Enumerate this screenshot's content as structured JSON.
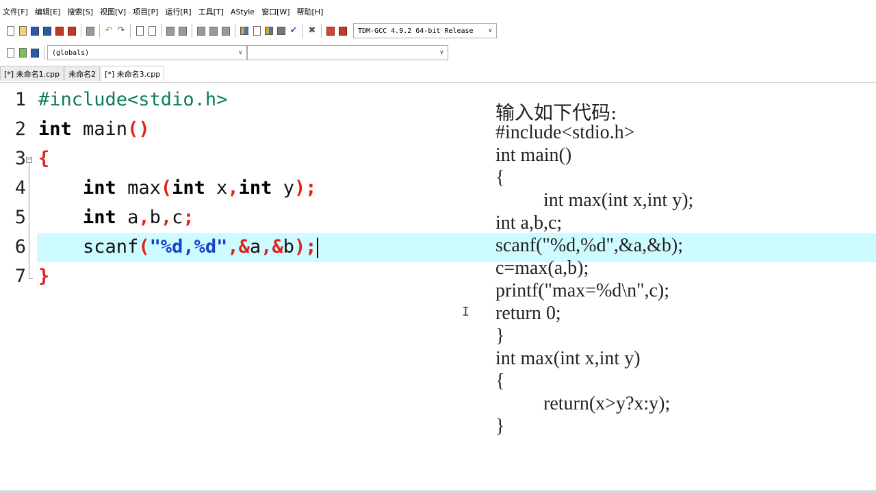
{
  "menu": [
    "文件[F]",
    "编辑[E]",
    "搜索[S]",
    "视图[V]",
    "项目[P]",
    "运行[R]",
    "工具[T]",
    "AStyle",
    "窗口[W]",
    "帮助[H]"
  ],
  "toolbar": {
    "compiler": "TDM-GCC 4.9.2 64-bit Release",
    "scope": "(globals)",
    "member": ""
  },
  "tabs": [
    "[*] 未命名1.cpp",
    "未命名2",
    "[*] 未命名3.cpp"
  ],
  "active_tab": 2,
  "editor": {
    "line_numbers": [
      "1",
      "2",
      "3",
      "4",
      "5",
      "6",
      "7"
    ],
    "lines": {
      "l1": "#include<stdio.h>",
      "l2_kw": "int",
      "l2_rest": " main",
      "l2_paren": "()",
      "l3": "{",
      "l4": {
        "indent": "    ",
        "kw1": "int",
        "name": " max",
        "p1": "(",
        "kw2": "int",
        "x": " x",
        "comma": ",",
        "kw3": "int",
        "y": " y",
        "p2": ");"
      },
      "l5": {
        "indent": "    ",
        "kw": "int",
        "a": " a",
        "c1": ",",
        "b": "b",
        "c2": ",",
        "c": "c",
        "semi": ";"
      },
      "l6": {
        "indent": "    ",
        "fn": "scanf",
        "p1": "(",
        "str": "\"%d,%d\"",
        "c1": ",",
        "amp1": "&",
        "a": "a",
        "c2": ",",
        "amp2": "&",
        "b": "b",
        "p2": ");"
      },
      "l7": "}"
    },
    "highlighted_line": 6
  },
  "overlay": {
    "title": "输入如下代码:",
    "lines": [
      "#include<stdio.h>",
      "int main()",
      "{",
      "          int max(int x,int y);",
      "int a,b,c;",
      "scanf(\"%d,%d\",&a,&b);",
      "c=max(a,b);",
      "printf(\"max=%d\\n\",c);",
      "return 0;",
      "}",
      "int max(int x,int y)",
      "{",
      "          return(x>y?x:y);",
      "}"
    ]
  },
  "colors": {
    "line_highlight": "#cdfbff",
    "keyword": "#000000",
    "preprocessor": "#0c7a5e",
    "punctuation": "#e0201a",
    "string": "#1640c8"
  }
}
